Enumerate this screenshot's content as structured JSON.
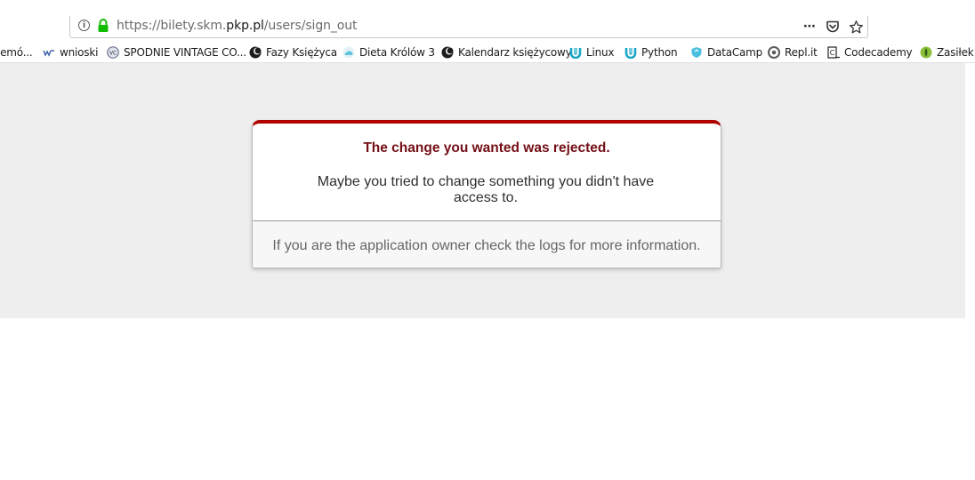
{
  "browser": {
    "url_prefix": "https://bilety.skm.",
    "url_host": "pkp.pl",
    "url_path": "/users/sign_out",
    "info_icon_glyph": "i",
    "actions_icon": "⋯"
  },
  "bookmarks": [
    {
      "label": "zemó...",
      "icon": "partial"
    },
    {
      "label": "wnioski",
      "icon": "wnioski-icon"
    },
    {
      "label": "SPODNIE VINTAGE CO...",
      "icon": "shop-icon"
    },
    {
      "label": "Fazy Księżyca",
      "icon": "moon-icon"
    },
    {
      "label": "Dieta Królów 3",
      "icon": "cloud-icon"
    },
    {
      "label": "Kalendarz księżycowy",
      "icon": "moon-icon"
    },
    {
      "label": "Linux",
      "icon": "udemy-icon"
    },
    {
      "label": "Python",
      "icon": "udemy-icon"
    },
    {
      "label": "DataCamp",
      "icon": "datacamp-icon"
    },
    {
      "label": "Repl.it",
      "icon": "replit-icon"
    },
    {
      "label": "Codecademy",
      "icon": "codecademy-icon"
    },
    {
      "label": "Zasiłek",
      "icon": "leaf-icon"
    }
  ],
  "error": {
    "title": "The change you wanted was rejected.",
    "message": "Maybe you tried to change something you didn't have access to.",
    "footer": "If you are the application owner check the logs for more information."
  },
  "colors": {
    "accent_red": "#b00100",
    "title_color": "#730e15",
    "page_bg": "#eeeeee",
    "lock_green": "#12bc00"
  }
}
